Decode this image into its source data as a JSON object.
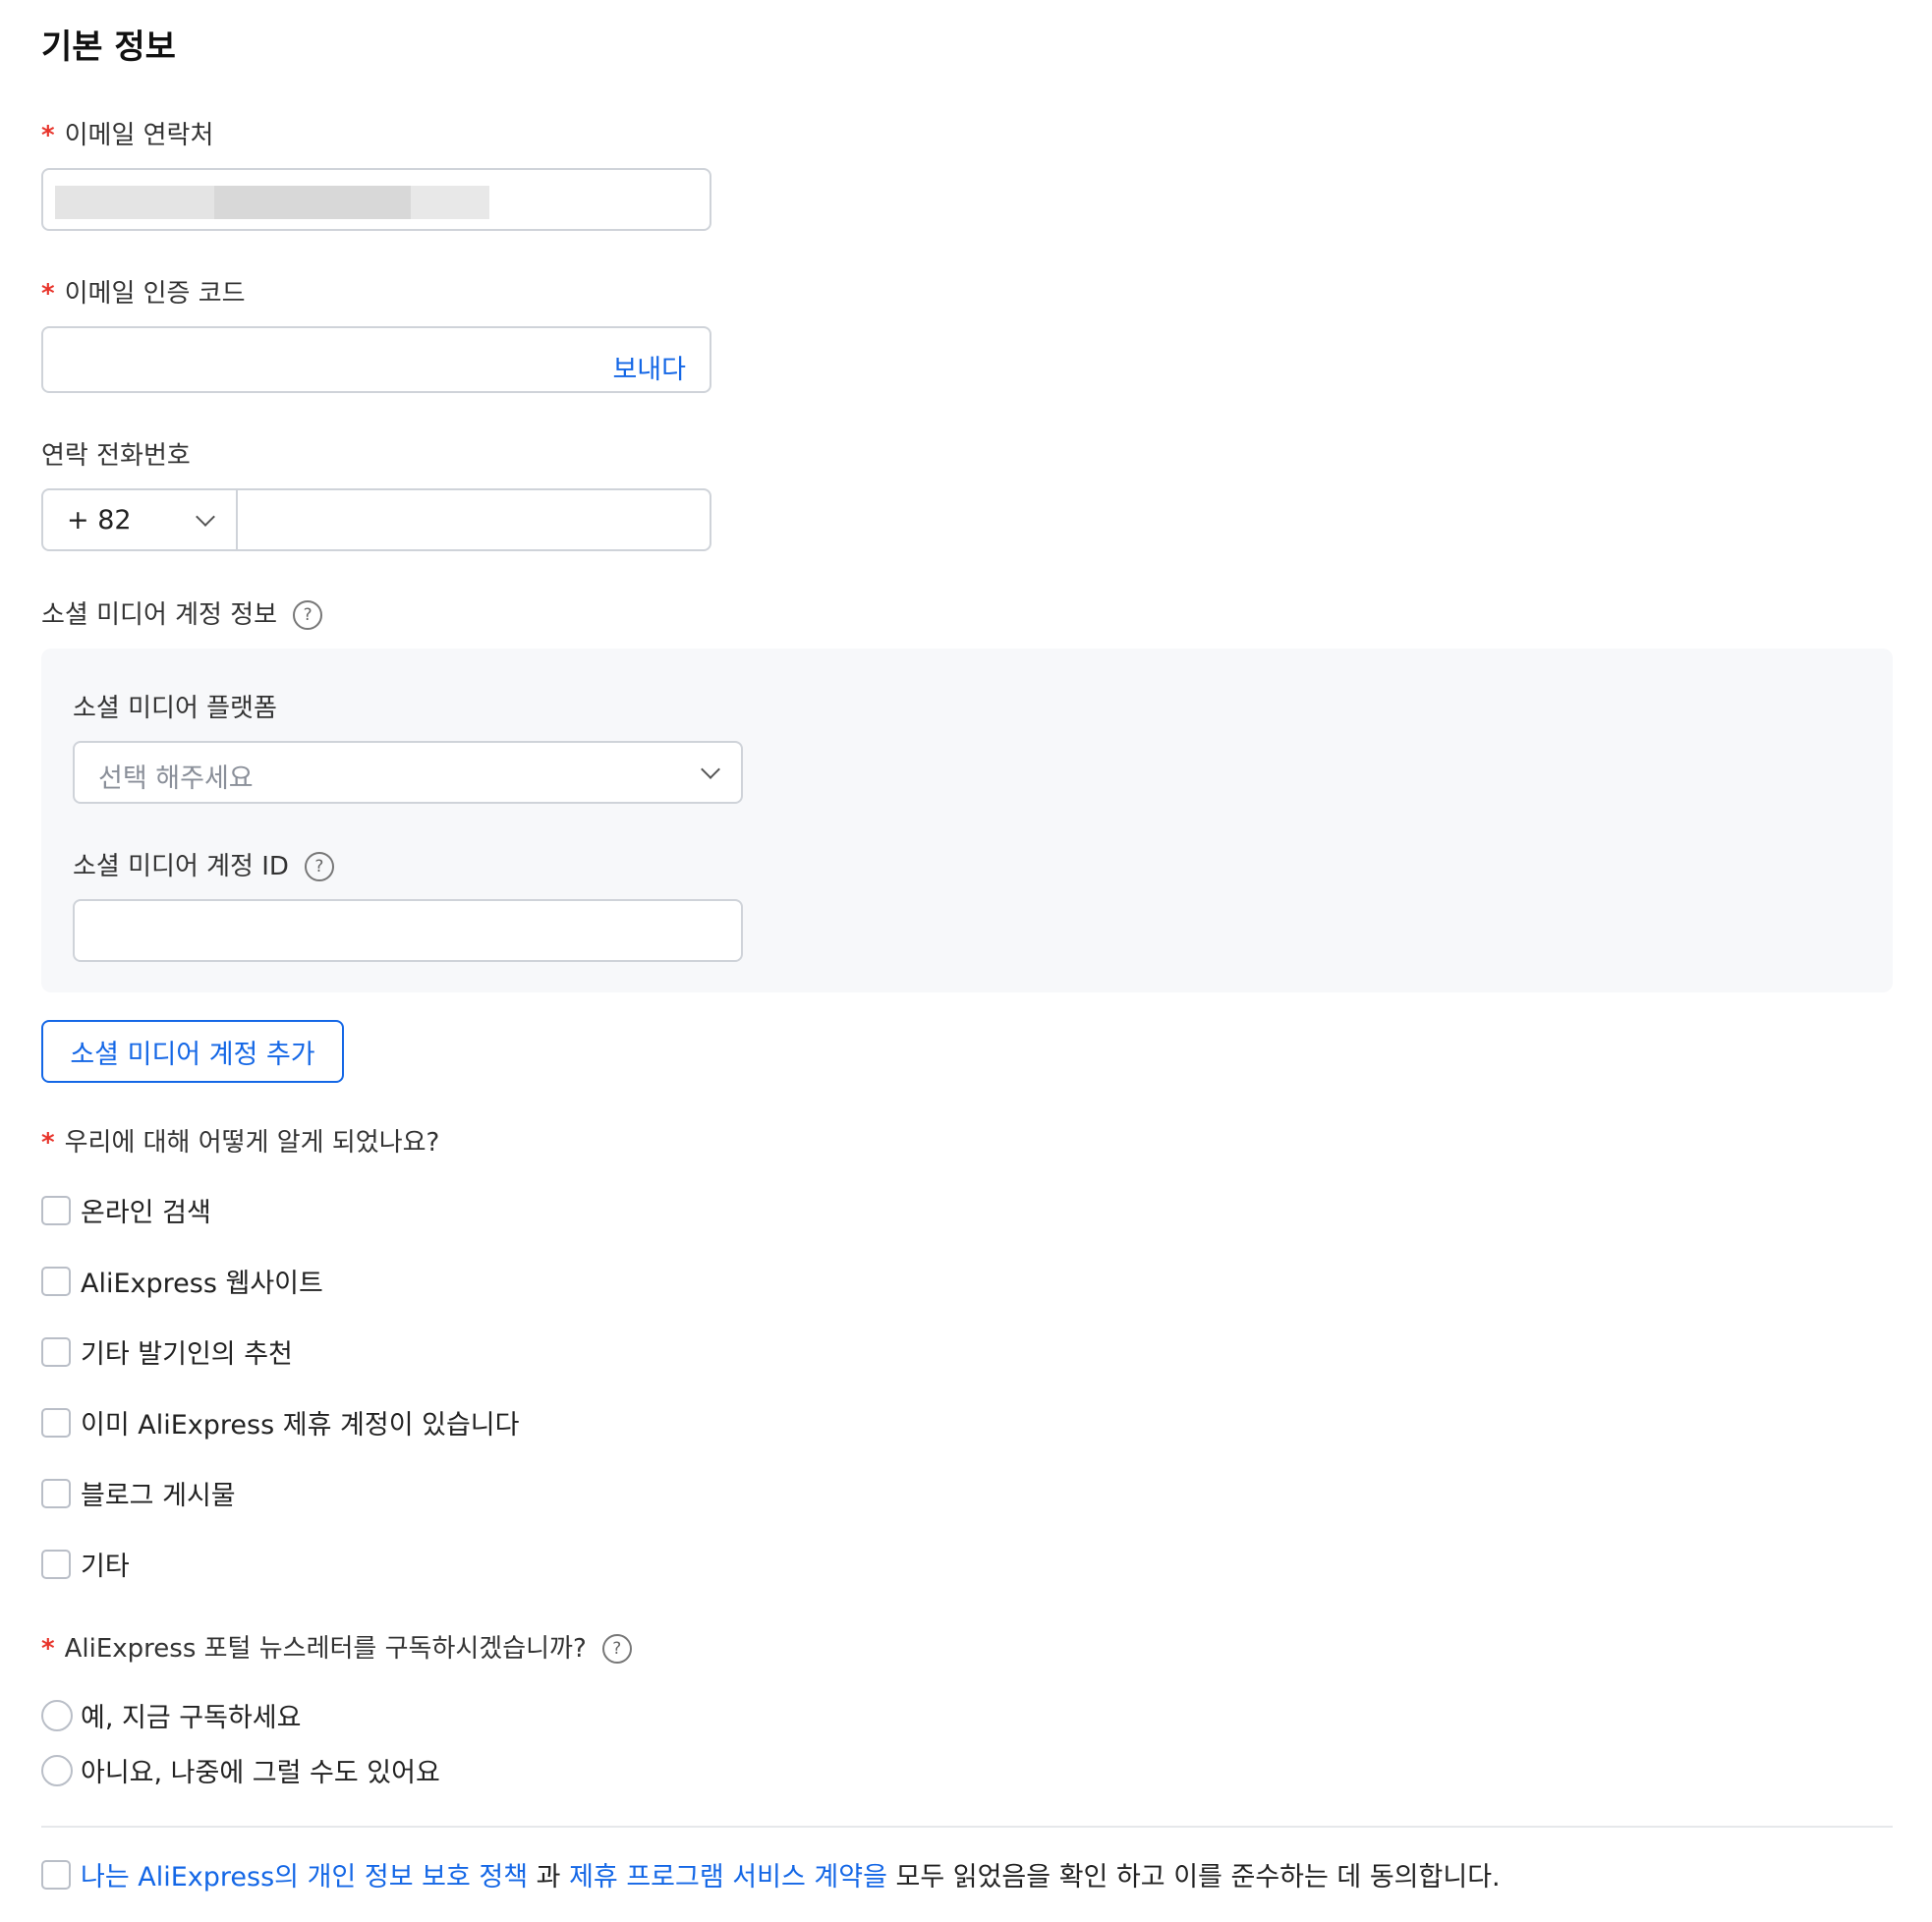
{
  "section": {
    "title": "기본 정보"
  },
  "email": {
    "label": "이메일 연락처",
    "required_mark": "*"
  },
  "email_code": {
    "label": "이메일 인증 코드",
    "required_mark": "*",
    "send_label": "보내다"
  },
  "phone": {
    "label": "연락 전화번호",
    "country_code": "+ 82"
  },
  "social": {
    "section_label": "소셜 미디어 계정 정보",
    "platform_label": "소셜 미디어 플랫폼",
    "platform_placeholder": "선택 해주세요",
    "account_id_label": "소셜 미디어 계정 ID",
    "add_button": "소셜 미디어 계정 추가"
  },
  "help_glyph": "?",
  "source": {
    "label": "우리에 대해 어떻게 알게 되었나요?",
    "required_mark": "*",
    "options": [
      "온라인 검색",
      "AliExpress 웹사이트",
      "기타 발기인의 추천",
      "이미 AliExpress 제휴 계정이 있습니다",
      "블로그 게시물",
      "기타"
    ]
  },
  "newsletter": {
    "label": "AliExpress 포털 뉴스레터를 구독하시겠습니까?",
    "required_mark": "*",
    "options": [
      "예, 지금 구독하세요",
      "아니요, 나중에 그럴 수도 있어요"
    ]
  },
  "agreement": {
    "link1": "나는 AliExpress의 개인 정보 보호 정책",
    "mid": " 과 ",
    "link2": "제휴 프로그램 서비스 계약을",
    "tail": " 모두 읽었음을 확인 하고 이를 준수하는 데 동의합니다."
  },
  "colors": {
    "accent": "#1467e6",
    "required": "#e8342b",
    "panel_bg": "#f7f8fa",
    "border": "#cfd3d9"
  }
}
